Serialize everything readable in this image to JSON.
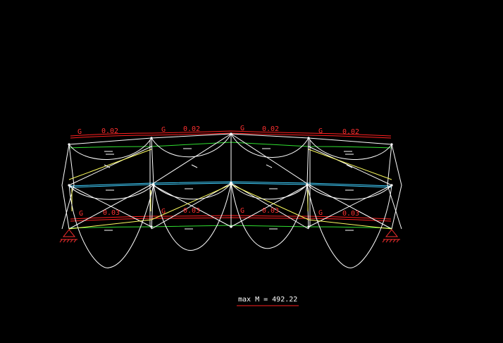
{
  "colors": {
    "background": "#000000",
    "frame": "#ffffff",
    "load_line": "#ff2020",
    "load_text": "#ff3030",
    "beam_axis": "#30e030",
    "mid_beam": "#40d0ff",
    "bracing": "#ffff60",
    "moment_curve": "#ffffff",
    "support": "#ff3030"
  },
  "top_loads": [
    {
      "label": "G",
      "value": "0.02"
    },
    {
      "label": "G",
      "value": "0.02"
    },
    {
      "label": "G",
      "value": "0.02"
    },
    {
      "label": "G",
      "value": "0.02"
    }
  ],
  "bottom_loads": [
    {
      "label": "G",
      "value": "0.03"
    },
    {
      "label": "G",
      "value": "0.03"
    },
    {
      "label": "G",
      "value": "0.03"
    },
    {
      "label": "G",
      "value": "0.03"
    }
  ],
  "summary": {
    "text": "max M = 492.22"
  }
}
